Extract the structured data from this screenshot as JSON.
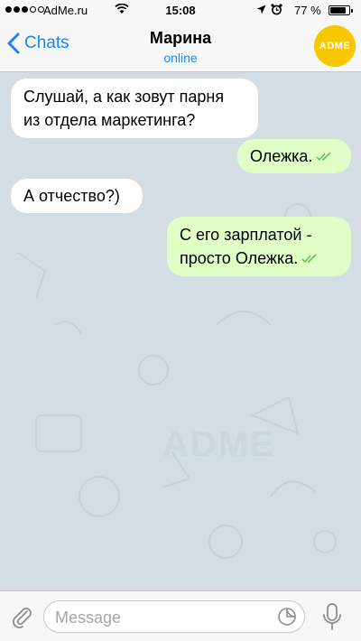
{
  "status_bar": {
    "carrier": "AdMe.ru",
    "time": "15:08",
    "battery_percent": "77 %",
    "battery_level": 0.77,
    "icons": [
      "signal-dots",
      "wifi-icon",
      "location-icon",
      "alarm-icon",
      "battery-icon"
    ]
  },
  "nav": {
    "back_label": "Chats",
    "contact_name": "Марина",
    "contact_status": "online",
    "avatar_text": "ADME"
  },
  "messages": [
    {
      "direction": "incoming",
      "lines": [
        "Слушай, а как зовут парня",
        "из отдела маркетинга?"
      ]
    },
    {
      "direction": "outgoing",
      "lines": [
        "Олежка."
      ],
      "read": true
    },
    {
      "direction": "incoming",
      "lines": [
        "А отчество?)"
      ]
    },
    {
      "direction": "outgoing",
      "lines": [
        "С его зарплатой -",
        "просто Олежка."
      ],
      "read": true
    }
  ],
  "input": {
    "placeholder": "Message"
  },
  "watermark": "ADME",
  "colors": {
    "accent": "#1b84f5",
    "outgoing_bubble": "#e1fec6",
    "incoming_bubble": "#ffffff",
    "chat_background": "#d4dde4",
    "avatar": "#f7c700",
    "read_ticks": "#5dc452"
  }
}
